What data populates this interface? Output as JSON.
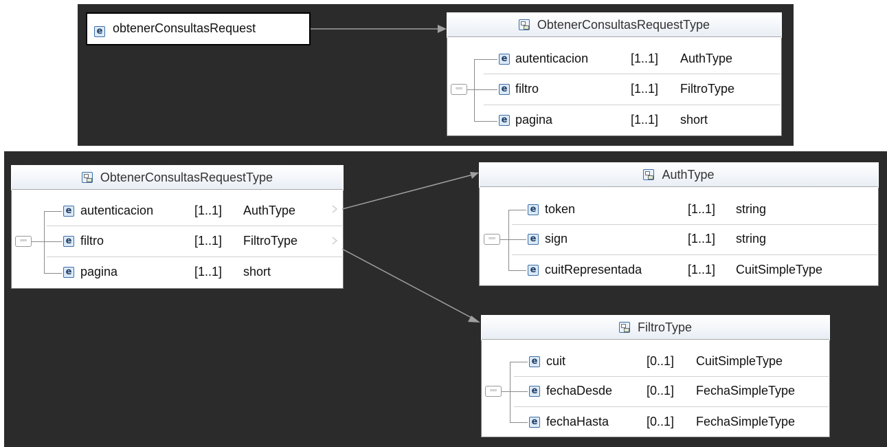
{
  "top": {
    "element": {
      "name": "obtenerConsultasRequest",
      "icon": "element-icon"
    },
    "type": {
      "title": "ObtenerConsultasRequestType",
      "rows": [
        {
          "name": "autenticacion",
          "card": "[1..1]",
          "type": "AuthType"
        },
        {
          "name": "filtro",
          "card": "[1..1]",
          "type": "FiltroType"
        },
        {
          "name": "pagina",
          "card": "[1..1]",
          "type": "short"
        }
      ]
    }
  },
  "bottom": {
    "request_type": {
      "title": "ObtenerConsultasRequestType",
      "rows": [
        {
          "name": "autenticacion",
          "card": "[1..1]",
          "type": "AuthType"
        },
        {
          "name": "filtro",
          "card": "[1..1]",
          "type": "FiltroType"
        },
        {
          "name": "pagina",
          "card": "[1..1]",
          "type": "short"
        }
      ]
    },
    "auth_type": {
      "title": "AuthType",
      "rows": [
        {
          "name": "token",
          "card": "[1..1]",
          "type": "string"
        },
        {
          "name": "sign",
          "card": "[1..1]",
          "type": "string"
        },
        {
          "name": "cuitRepresentada",
          "card": "[1..1]",
          "type": "CuitSimpleType"
        }
      ]
    },
    "filtro_type": {
      "title": "FiltroType",
      "rows": [
        {
          "name": "cuit",
          "card": "[0..1]",
          "type": "CuitSimpleType"
        },
        {
          "name": "fechaDesde",
          "card": "[0..1]",
          "type": "FechaSimpleType"
        },
        {
          "name": "fechaHasta",
          "card": "[0..1]",
          "type": "FechaSimpleType"
        }
      ]
    }
  },
  "colors": {
    "panel": "#2b2b2b",
    "box_border": "#7a7a7a",
    "icon_blue": "#3b6ea5",
    "connector": "#9a9a9a"
  },
  "icons": {
    "element": "element-icon",
    "complex_type": "complex-type-icon",
    "sequence": "sequence-icon"
  }
}
